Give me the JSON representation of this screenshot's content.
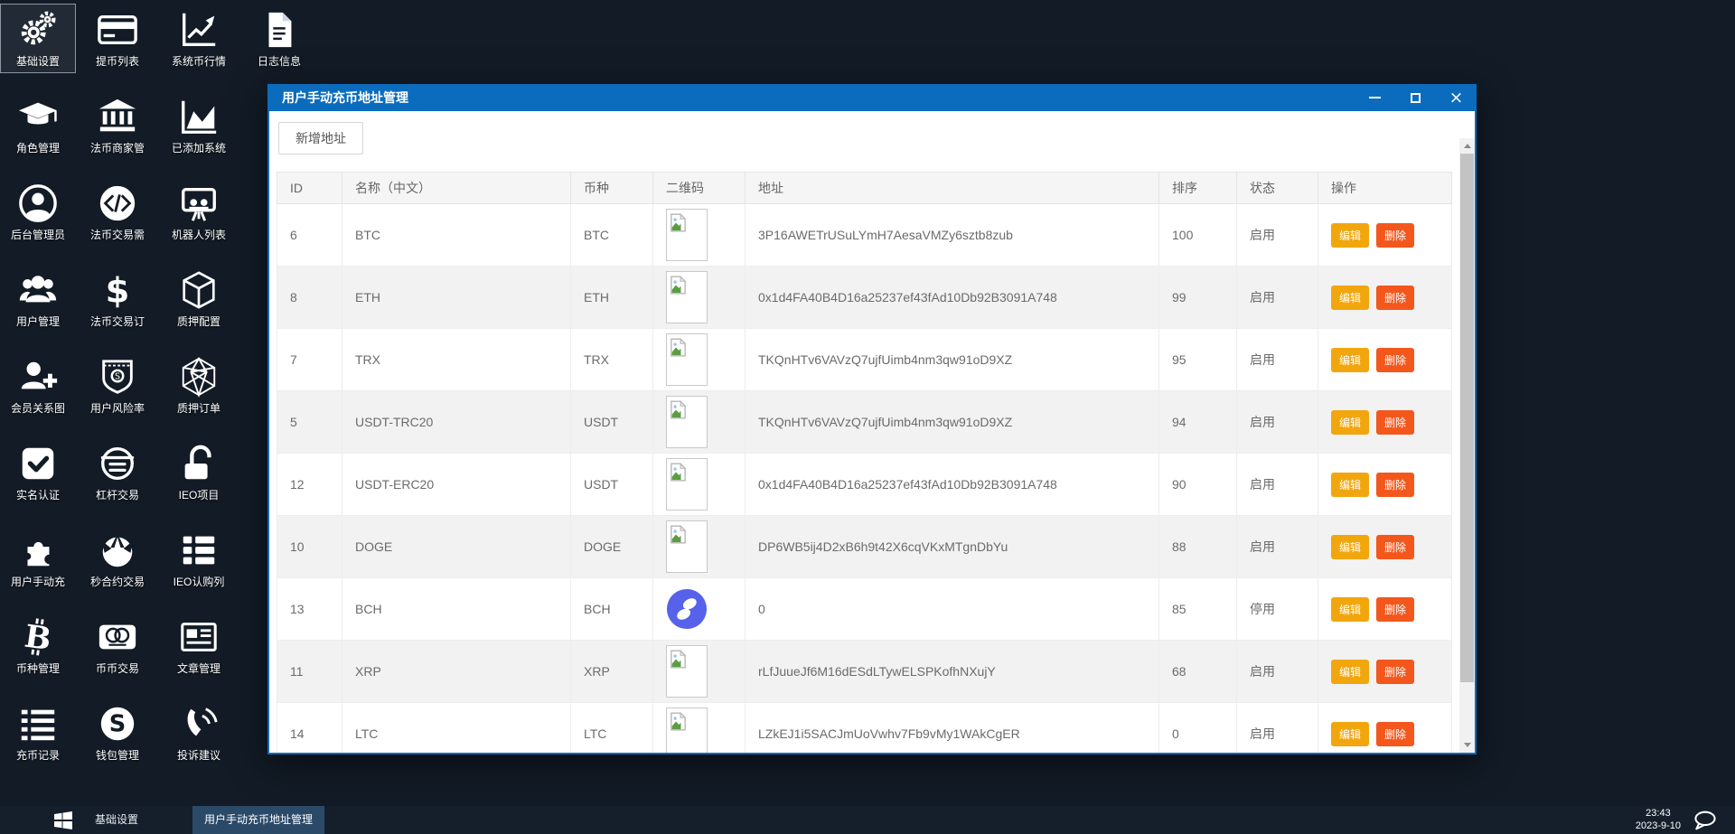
{
  "desktop": {
    "icons": [
      {
        "label": "基础设置",
        "icon": "gears",
        "selected": true
      },
      {
        "label": "提币列表",
        "icon": "card",
        "selected": false
      },
      {
        "label": "系统币行情",
        "icon": "line-chart",
        "selected": false
      },
      {
        "label": "日志信息",
        "icon": "document",
        "selected": false
      },
      {
        "label": "角色管理",
        "icon": "graduation-cap",
        "selected": false
      },
      {
        "label": "法币商家管",
        "icon": "bank",
        "selected": false
      },
      {
        "label": "已添加系统",
        "icon": "area-chart",
        "selected": false
      },
      {
        "label": "后台管理员",
        "icon": "user-circle",
        "selected": false
      },
      {
        "label": "法币交易需",
        "icon": "diamond-badge",
        "selected": false
      },
      {
        "label": "机器人列表",
        "icon": "robot-board",
        "selected": false
      },
      {
        "label": "用户管理",
        "icon": "users",
        "selected": false
      },
      {
        "label": "法币交易订",
        "icon": "dollar",
        "selected": false
      },
      {
        "label": "质押配置",
        "icon": "cube",
        "selected": false
      },
      {
        "label": "会员关系图",
        "icon": "user-plus",
        "selected": false
      },
      {
        "label": "用户风险率",
        "icon": "shield-badge",
        "selected": false
      },
      {
        "label": "质押订单",
        "icon": "polyhedron",
        "selected": false
      },
      {
        "label": "实名认证",
        "icon": "check-square",
        "selected": false
      },
      {
        "label": "杠杆交易",
        "icon": "leverage-circle",
        "selected": false
      },
      {
        "label": "IEO项目",
        "icon": "unlock",
        "selected": false
      },
      {
        "label": "用户手动充",
        "icon": "puzzle",
        "selected": false
      },
      {
        "label": "秒合约交易",
        "icon": "rebel",
        "selected": false
      },
      {
        "label": "IEO认购列",
        "icon": "list-grid",
        "selected": false
      },
      {
        "label": "币种管理",
        "icon": "bitcoin",
        "selected": false
      },
      {
        "label": "币币交易",
        "icon": "mastercard",
        "selected": false
      },
      {
        "label": "文章管理",
        "icon": "news",
        "selected": false
      },
      {
        "label": "充币记录",
        "icon": "list-lines",
        "selected": false
      },
      {
        "label": "钱包管理",
        "icon": "skype",
        "selected": false
      },
      {
        "label": "投诉建议",
        "icon": "phone",
        "selected": false
      }
    ]
  },
  "window": {
    "title": "用户手动充币地址管理",
    "add_button": "新增地址",
    "table": {
      "headers": [
        "ID",
        "名称（中文）",
        "币种",
        "二维码",
        "地址",
        "排序",
        "状态",
        "操作"
      ],
      "edit_label": "编辑",
      "delete_label": "删除",
      "rows": [
        {
          "id": "6",
          "name": "BTC",
          "coin": "BTC",
          "qr": "broken-image",
          "address": "3P16AWETrUSuLYmH7AesaVMZy6sztb8zub",
          "sort": "100",
          "status": "启用"
        },
        {
          "id": "8",
          "name": "ETH",
          "coin": "ETH",
          "qr": "broken-image",
          "address": "0x1d4FA40B4D16a25237ef43fAd10Db92B3091A748",
          "sort": "99",
          "status": "启用"
        },
        {
          "id": "7",
          "name": "TRX",
          "coin": "TRX",
          "qr": "broken-image",
          "address": "TKQnHTv6VAVzQ7ujfUimb4nm3qw91oD9XZ",
          "sort": "95",
          "status": "启用"
        },
        {
          "id": "5",
          "name": "USDT-TRC20",
          "coin": "USDT",
          "qr": "broken-image",
          "address": "TKQnHTv6VAVzQ7ujfUimb4nm3qw91oD9XZ",
          "sort": "94",
          "status": "启用"
        },
        {
          "id": "12",
          "name": "USDT-ERC20",
          "coin": "USDT",
          "qr": "broken-image",
          "address": "0x1d4FA40B4D16a25237ef43fAd10Db92B3091A748",
          "sort": "90",
          "status": "启用"
        },
        {
          "id": "10",
          "name": "DOGE",
          "coin": "DOGE",
          "qr": "broken-image",
          "address": "DP6WB5ij4D2xB6h9t42X6cqVKxMTgnDbYu",
          "sort": "88",
          "status": "启用"
        },
        {
          "id": "13",
          "name": "BCH",
          "coin": "BCH",
          "qr": "logo-circle",
          "address": "0",
          "sort": "85",
          "status": "停用"
        },
        {
          "id": "11",
          "name": "XRP",
          "coin": "XRP",
          "qr": "broken-image",
          "address": "rLfJuueJf6M16dESdLTywELSPKofhNXujY",
          "sort": "68",
          "status": "启用"
        },
        {
          "id": "14",
          "name": "LTC",
          "coin": "LTC",
          "qr": "broken-image",
          "address": "LZkEJ1i5SACJmUoVwhv7Fb9vMy1WAkCgER",
          "sort": "0",
          "status": "启用"
        }
      ]
    }
  },
  "taskbar": {
    "items": [
      {
        "label": "基础设置",
        "active": false
      },
      {
        "label": "用户手动充币地址管理",
        "active": true
      }
    ],
    "clock": {
      "time": "23:43",
      "date": "2023-9-10"
    }
  },
  "colors": {
    "desktop_bg": "#121b26",
    "taskbar_bg": "#151f2c",
    "titlebar_accent": "#0b6cbd",
    "task_active": "#2b4a68",
    "edit_button": "#f2a60d",
    "delete_button": "#f4571c",
    "coin_logo": "#5562e9"
  }
}
